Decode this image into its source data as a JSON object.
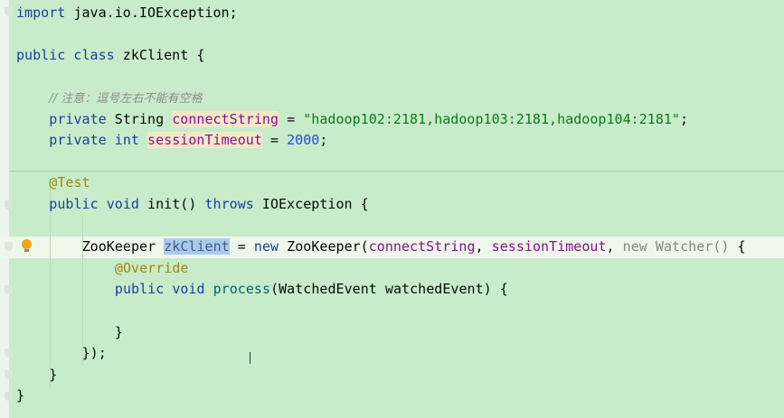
{
  "editor": {
    "language": "java",
    "lines": [
      {
        "row": 0,
        "indent": 0,
        "tokens": [
          [
            "import ",
            "kw"
          ],
          [
            "java.io.IOException;",
            ""
          ]
        ]
      },
      {
        "row": 2,
        "indent": 0,
        "tokens": [
          [
            "public class ",
            "kw"
          ],
          [
            "zkClient {",
            ""
          ]
        ]
      },
      {
        "row": 4,
        "indent": 1,
        "tokens": [
          [
            "// 注意：逗号左右不能有空格",
            "cmt"
          ]
        ]
      },
      {
        "row": 5,
        "indent": 1,
        "tokens": [
          [
            "private ",
            "kw"
          ],
          [
            "String ",
            ""
          ],
          [
            "connectString",
            "fld"
          ],
          [
            " = ",
            ""
          ],
          [
            "\"hadoop102:2181,hadoop103:2181,hadoop104:2181\"",
            "str"
          ],
          [
            ";",
            ""
          ]
        ]
      },
      {
        "row": 6,
        "indent": 1,
        "tokens": [
          [
            "private int ",
            "kw"
          ],
          [
            "sessionTimeout",
            "fld"
          ],
          [
            " = ",
            ""
          ],
          [
            "2000",
            "num"
          ],
          [
            ";",
            ""
          ]
        ]
      },
      {
        "row": 8,
        "indent": 1,
        "tokens": [
          [
            "@Test",
            "ann"
          ]
        ]
      },
      {
        "row": 9,
        "indent": 1,
        "tokens": [
          [
            "public void ",
            "kw"
          ],
          [
            "init() ",
            ""
          ],
          [
            "throws ",
            "kw"
          ],
          [
            "IOException {",
            ""
          ]
        ]
      },
      {
        "row": 11,
        "indent": 2,
        "tokens": [
          [
            "ZooKeeper ",
            ""
          ],
          [
            "zkClient",
            "sel"
          ],
          [
            " = ",
            ""
          ],
          [
            "new ",
            "kw"
          ],
          [
            "ZooKeeper(",
            ""
          ],
          [
            "connectString",
            "fldp"
          ],
          [
            ", ",
            ""
          ],
          [
            "sessionTimeout",
            "fldp"
          ],
          [
            ", ",
            ""
          ],
          [
            "new Watcher()",
            "dim"
          ],
          [
            " {",
            ""
          ]
        ]
      },
      {
        "row": 12,
        "indent": 3,
        "tokens": [
          [
            "@Override",
            "ann"
          ]
        ]
      },
      {
        "row": 13,
        "indent": 3,
        "tokens": [
          [
            "public void ",
            "kw"
          ],
          [
            "process",
            "fn"
          ],
          [
            "(WatchedEvent watchedEvent) {",
            ""
          ]
        ]
      },
      {
        "row": 15,
        "indent": 3,
        "tokens": [
          [
            "}",
            ""
          ]
        ]
      },
      {
        "row": 16,
        "indent": 2,
        "tokens": [
          [
            "});",
            ""
          ]
        ]
      },
      {
        "row": 17,
        "indent": 1,
        "tokens": [
          [
            "}",
            ""
          ]
        ]
      },
      {
        "row": 18,
        "indent": 0,
        "tokens": [
          [
            "}",
            ""
          ]
        ]
      }
    ],
    "current_line": 11,
    "selected_word": "zkClient",
    "intention_icon": "lightbulb-icon"
  }
}
